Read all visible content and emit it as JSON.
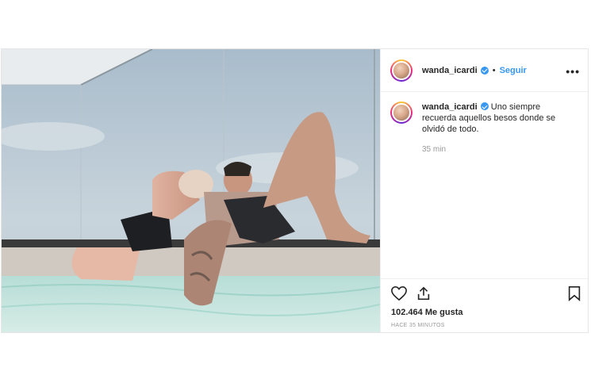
{
  "post": {
    "username": "wanda_icardi",
    "follow_label": "Seguir",
    "separator": "•",
    "more_label": "•••",
    "caption": "Uno siempre recuerda aquellos besos donde se olvidó de todo.",
    "caption_time": "35 min",
    "likes": "102.464 Me gusta",
    "timestamp": "HACE 35 MINUTOS"
  },
  "icons": {
    "verified": "verified-badge-icon",
    "like": "heart-outline-icon",
    "share": "share-upload-icon",
    "save": "bookmark-outline-icon"
  },
  "colors": {
    "link_blue": "#3897f0",
    "verified_blue": "#3897f0",
    "muted_text": "#999999",
    "border": "#efefef"
  }
}
